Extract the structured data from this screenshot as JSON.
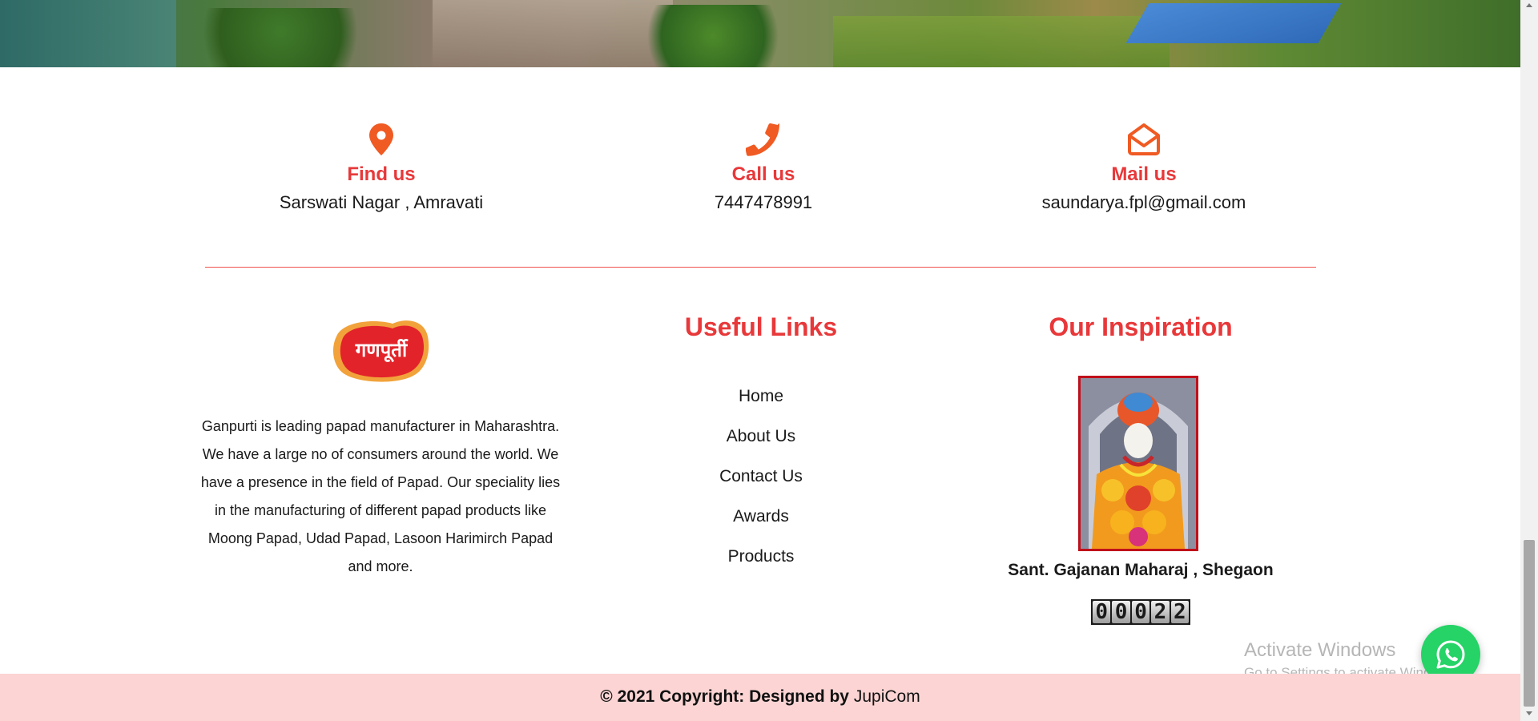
{
  "contact": [
    {
      "title": "Find us",
      "value": "Sarswati Nagar , Amravati",
      "icon": "map-pin-icon"
    },
    {
      "title": "Call us",
      "value": "7447478991",
      "icon": "phone-icon"
    },
    {
      "title": "Mail us",
      "value": "saundarya.fpl@gmail.com",
      "icon": "envelope-open-icon"
    }
  ],
  "about": {
    "logo_text": "गणपूर्ती",
    "description": "Ganpurti is leading papad manufacturer in Maharashtra. We have a large no of consumers around the world. We have a presence in the field of Papad. Our speciality lies in the manufacturing of different papad products like Moong Papad, Udad Papad, Lasoon Harimirch Papad and more."
  },
  "useful_links": {
    "title": "Useful Links",
    "items": [
      "Home",
      "About Us",
      "Contact Us",
      "Awards",
      "Products"
    ]
  },
  "inspiration": {
    "title": "Our Inspiration",
    "caption": "Sant. Gajanan Maharaj , Shegaon",
    "counter_digits": [
      "0",
      "0",
      "0",
      "2",
      "2"
    ]
  },
  "windows_watermark": {
    "line1": "Activate Windows",
    "line2": "Go to Settings to activate Windows."
  },
  "footer": {
    "copyright_prefix": "© 2021 Copyright: Designed by",
    "brand": "JupiCom"
  },
  "colors": {
    "accent": "#e8383a",
    "icon_orange": "#f05a23",
    "footer_bg": "#fbd4d3",
    "whatsapp": "#25d366"
  }
}
